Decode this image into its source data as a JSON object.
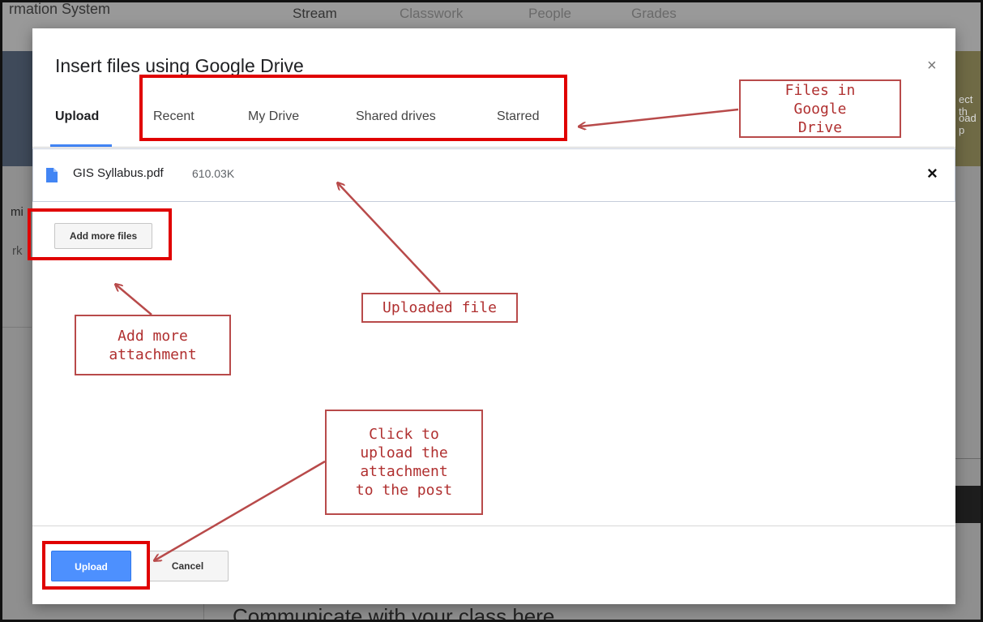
{
  "background": {
    "app_title": "rmation System",
    "tabs": [
      "Stream",
      "Classwork",
      "People",
      "Grades"
    ],
    "side_text_right_1": "ect th",
    "side_text_right_2": "oad p",
    "side_text_left_1": "mi",
    "side_text_left_2": "rk",
    "footer_text": "Communicate with your class here"
  },
  "dialog": {
    "title": "Insert files using Google Drive",
    "close_icon": "×",
    "tabs": [
      {
        "label": "Upload",
        "active": true
      },
      {
        "label": "Recent"
      },
      {
        "label": "My Drive"
      },
      {
        "label": "Shared drives"
      },
      {
        "label": "Starred"
      }
    ],
    "file": {
      "icon": "document-icon",
      "name": "GIS Syllabus.pdf",
      "size": "610.03K",
      "remove_icon": "×"
    },
    "add_more_label": "Add more files",
    "upload_label": "Upload",
    "cancel_label": "Cancel"
  },
  "annotations": {
    "files_in_drive": "Files in Google Drive",
    "uploaded_file": "Uploaded file",
    "add_more_attachment": "Add more attachment",
    "click_to_upload": "Click to upload the attachment to the post"
  },
  "colors": {
    "accent_blue": "#4285f4",
    "upload_button": "#4d90fe",
    "annotation_red": "#e00000",
    "annotation_text": "#b03030"
  }
}
